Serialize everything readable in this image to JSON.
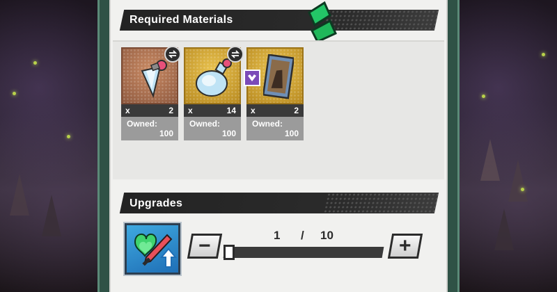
{
  "materials_section": {
    "title": "Required Materials",
    "items": [
      {
        "icon": "potion-shard-icon",
        "quantity_prefix": "x",
        "quantity": "2",
        "owned_label": "Owned:",
        "owned": "100",
        "exchangeable": true,
        "frame_color": "#b57a58"
      },
      {
        "icon": "potion-flask-icon",
        "quantity_prefix": "x",
        "quantity": "14",
        "owned_label": "Owned:",
        "owned": "100",
        "exchangeable": true,
        "frame_color": "#d6a83a"
      },
      {
        "icon": "character-card-icon",
        "quantity_prefix": "x",
        "quantity": "2",
        "owned_label": "Owned:",
        "owned": "100",
        "exchangeable": false,
        "frame_color": "#d6a83a"
      }
    ]
  },
  "upgrades_section": {
    "title": "Upgrades",
    "skill_icon": "attack-up-skill-icon",
    "current": "1",
    "separator": "/",
    "max": "10",
    "progress_fraction": 0.0,
    "minus_label": "−",
    "plus_label": "+"
  },
  "colors": {
    "accent_green": "#1fb85a",
    "header_dark": "#262626",
    "frame_green": "#2f5246"
  }
}
